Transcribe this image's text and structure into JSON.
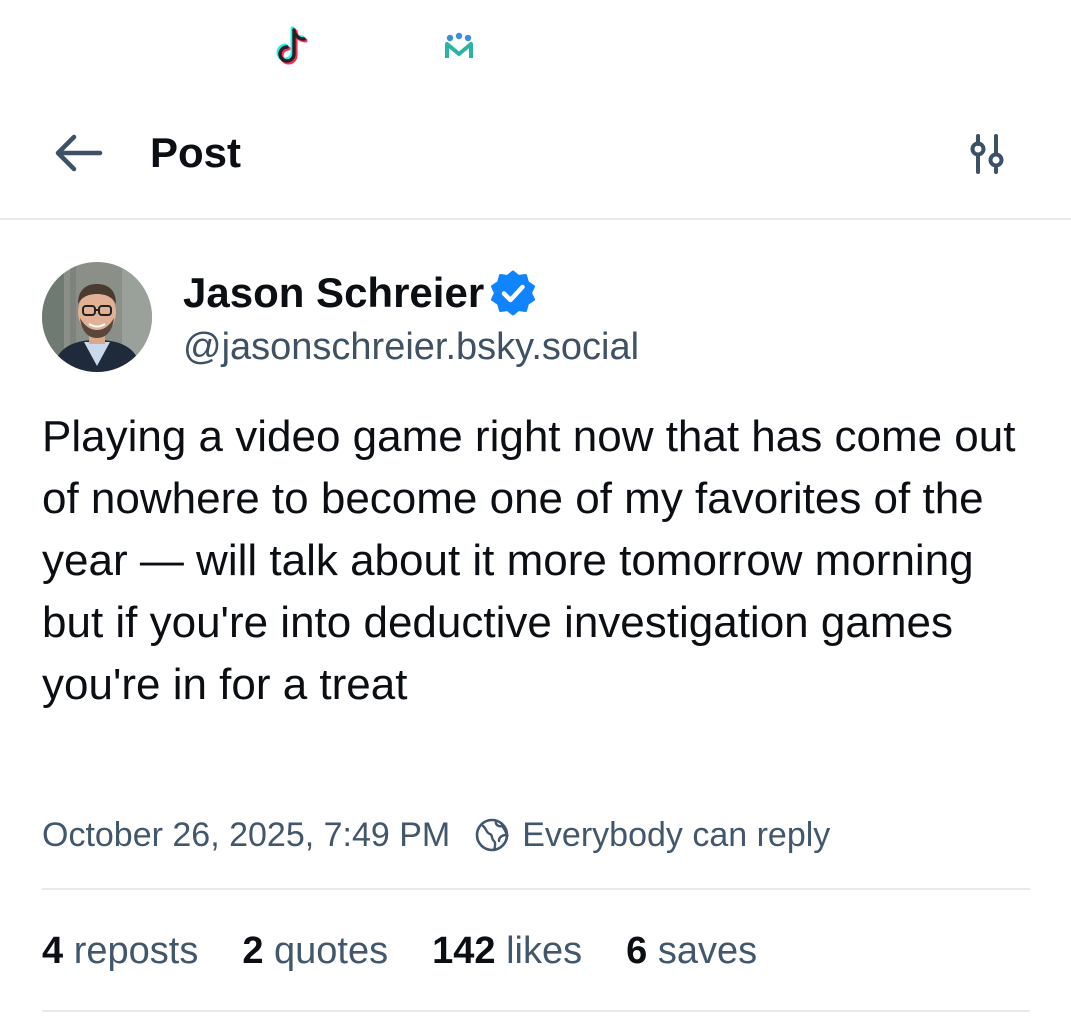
{
  "status_bar": {
    "icons": [
      "tiktok-icon",
      "app-notification-icon"
    ]
  },
  "header": {
    "title": "Post",
    "back_icon": "arrow-left-icon",
    "filter_icon": "sliders-icon"
  },
  "post": {
    "author": {
      "name": "Jason Schreier",
      "handle": "@jasonschreier.bsky.social",
      "verified": true
    },
    "text": "Playing a video game right now that has come out of nowhere to become one of my favorites of the year — will talk about it more tomorrow morning but if you're into deductive investigation games you're in for a treat",
    "timestamp": "October 26, 2025, 7:49 PM",
    "reply_setting": "Everybody can reply",
    "stats": {
      "reposts": {
        "count": "4",
        "label": "reposts"
      },
      "quotes": {
        "count": "2",
        "label": "quotes"
      },
      "likes": {
        "count": "142",
        "label": "likes"
      },
      "saves": {
        "count": "6",
        "label": "saves"
      }
    }
  },
  "colors": {
    "text": "#0b0f14",
    "muted": "#42576c",
    "verified": "#1083fe",
    "divider": "#e6e9ee"
  }
}
